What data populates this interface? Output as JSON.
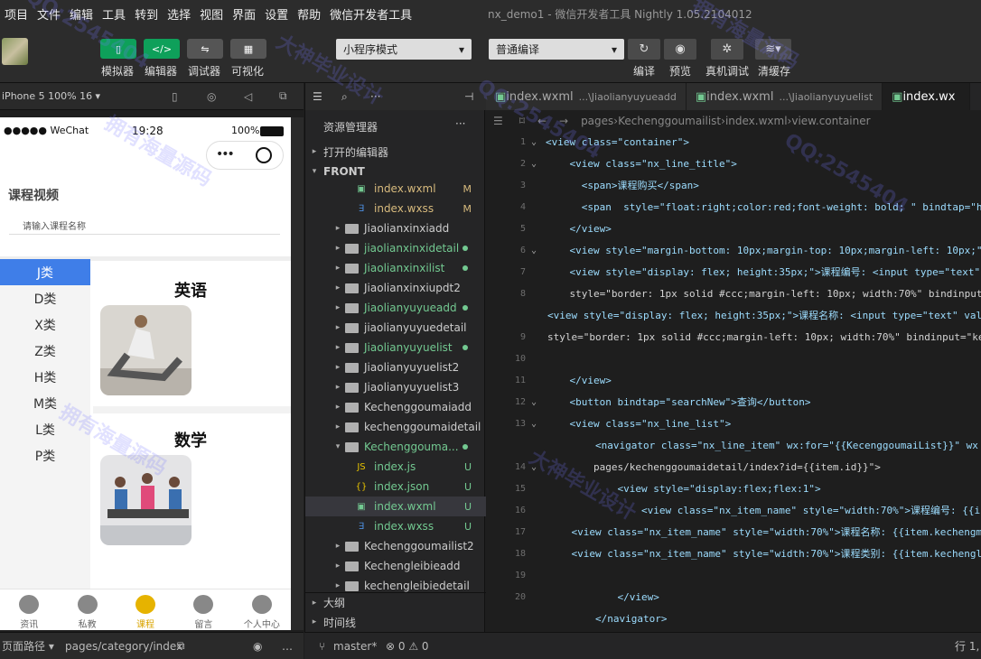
{
  "menu": [
    "项目",
    "文件",
    "编辑",
    "工具",
    "转到",
    "选择",
    "视图",
    "界面",
    "设置",
    "帮助",
    "微信开发者工具"
  ],
  "window_title": "nx_demo1 - 微信开发者工具 Nightly 1.05.2104012",
  "toolbar": {
    "simulator": "模拟器",
    "editor": "编辑器",
    "debugger": "调试器",
    "visual": "可视化",
    "mode": "小程序模式",
    "compile_mode": "普通编译",
    "compile": "编译",
    "preview": "预览",
    "real_debug": "真机调试",
    "clear_cache": "清缓存"
  },
  "simbar": {
    "device": "iPhone 5 100% 16 ▾"
  },
  "phone": {
    "carrier": "●●●●● WeChat",
    "time": "19:28",
    "battery": "100%",
    "page_title": "课程视频",
    "search_placeholder": "请输入课程名称",
    "categories": [
      "J类",
      "D类",
      "X类",
      "Z类",
      "H类",
      "M类",
      "L类",
      "P类"
    ],
    "card1_title": "英语",
    "card2_title": "数学",
    "tabs": [
      "资讯",
      "私教",
      "课程",
      "留言",
      "个人中心"
    ]
  },
  "leftbottom": {
    "page_path_label": "页面路径 ▾",
    "page_path": "pages/category/index"
  },
  "explorer": {
    "title": "资源管理器",
    "open_editors": "打开的编辑器",
    "front": "FRONT",
    "rows": [
      {
        "label": "index.wxml",
        "badge": "M"
      },
      {
        "label": "index.wxss",
        "badge": "M"
      },
      {
        "label": "Jiaolianxinxiadd",
        "badge": ""
      },
      {
        "label": "jiaolianxinxidetail",
        "badge": "●"
      },
      {
        "label": "Jiaolianxinxilist",
        "badge": "●"
      },
      {
        "label": "Jiaolianxinxiupdt2",
        "badge": ""
      },
      {
        "label": "Jiaolianyuyueadd",
        "badge": "●"
      },
      {
        "label": "jiaolianyuyuedetail",
        "badge": ""
      },
      {
        "label": "Jiaolianyuyuelist",
        "badge": "●"
      },
      {
        "label": "Jiaolianyuyuelist2",
        "badge": ""
      },
      {
        "label": "Jiaolianyuyuelist3",
        "badge": ""
      },
      {
        "label": "Kechenggoumaiadd",
        "badge": ""
      },
      {
        "label": "kechenggoumaidetail",
        "badge": ""
      },
      {
        "label": "Kechenggouma...",
        "badge": "●"
      },
      {
        "label": "index.js",
        "badge": "U"
      },
      {
        "label": "index.json",
        "badge": "U"
      },
      {
        "label": "index.wxml",
        "badge": "U"
      },
      {
        "label": "index.wxss",
        "badge": "U"
      },
      {
        "label": "Kechenggoumailist2",
        "badge": ""
      },
      {
        "label": "Kechengleibieadd",
        "badge": ""
      },
      {
        "label": "kechengleibiedetail",
        "badge": ""
      }
    ],
    "outline": "大纲",
    "timeline": "时间线"
  },
  "editor": {
    "tabs": [
      {
        "name": "index.wxml",
        "path": "...\\Jiaolianyuyueadd"
      },
      {
        "name": "index.wxml",
        "path": "...\\Jiaolianyuyuelist"
      },
      {
        "name": "index.wx",
        "path": ""
      }
    ],
    "crumb": [
      "pages",
      "Kechenggoumailist",
      "index.wxml",
      "view.container"
    ],
    "lines": [
      {
        "n": "1",
        "code": "<view class=\"container\">"
      },
      {
        "n": "2",
        "code": "    <view class=\"nx_line_title\">"
      },
      {
        "n": "3",
        "code": "      <span>课程购买</span>"
      },
      {
        "n": "4",
        "code": "      <span  style=\"float:right;color:red;font-weight: bold; \" bindtap=\"h"
      },
      {
        "n": "5",
        "code": "    </view>"
      },
      {
        "n": "6",
        "code": "    <view style=\"margin-bottom: 10px;margin-top: 10px;margin-left: 10px;\""
      },
      {
        "n": "7",
        "code": "    <view style=\"display: flex; height:35px;\">课程编号: <input type=\"text\""
      },
      {
        "n": "8",
        "code": "    style=\"border: 1px solid #ccc;margin-left: 10px; width:70%\" bindinput"
      },
      {
        "n": "",
        "code": "<view style=\"display: flex; height:35px;\">课程名称: <input type=\"text\" val"
      },
      {
        "n": "9",
        "code": "style=\"border: 1px solid #ccc;margin-left: 10px; width:70%\" bindinput=\"ke"
      },
      {
        "n": "10",
        "code": ""
      },
      {
        "n": "11",
        "code": "    </view>"
      },
      {
        "n": "12",
        "code": "    <button bindtap=\"searchNew\">查询</button>"
      },
      {
        "n": "13",
        "code": "    <view class=\"nx_line_list\">"
      },
      {
        "n": "",
        "code": "        <navigator class=\"nx_line_item\" wx:for=\"{{KecenggoumaiList}}\" wx"
      },
      {
        "n": "14",
        "code": "        pages/kechenggoumaidetail/index?id={{item.id}}\">"
      },
      {
        "n": "15",
        "code": "            <view style=\"display:flex;flex:1\">"
      },
      {
        "n": "16",
        "code": "                <view class=\"nx_item_name\" style=\"width:70%\">课程编号: {{i"
      },
      {
        "n": "17",
        "code": "    <view class=\"nx_item_name\" style=\"width:70%\">课程名称: {{item.kechengm"
      },
      {
        "n": "18",
        "code": "    <view class=\"nx_item_name\" style=\"width:70%\">课程类别: {{item.kechengl"
      },
      {
        "n": "19",
        "code": ""
      },
      {
        "n": "20",
        "code": "            </view>"
      },
      {
        "n": "",
        "code": "        </navigator>"
      }
    ]
  },
  "statusbar": {
    "branch": "master*",
    "problems": "⊗ 0 ⚠ 0",
    "position": "行 1,"
  },
  "watermarks": [
    "QQ:2545404",
    "拥有海量源码",
    "大神毕业设计",
    "QQ:2545404",
    "拥有海量源码",
    "QQ:2545404",
    "拥有海量源码",
    "大神毕业设计"
  ]
}
